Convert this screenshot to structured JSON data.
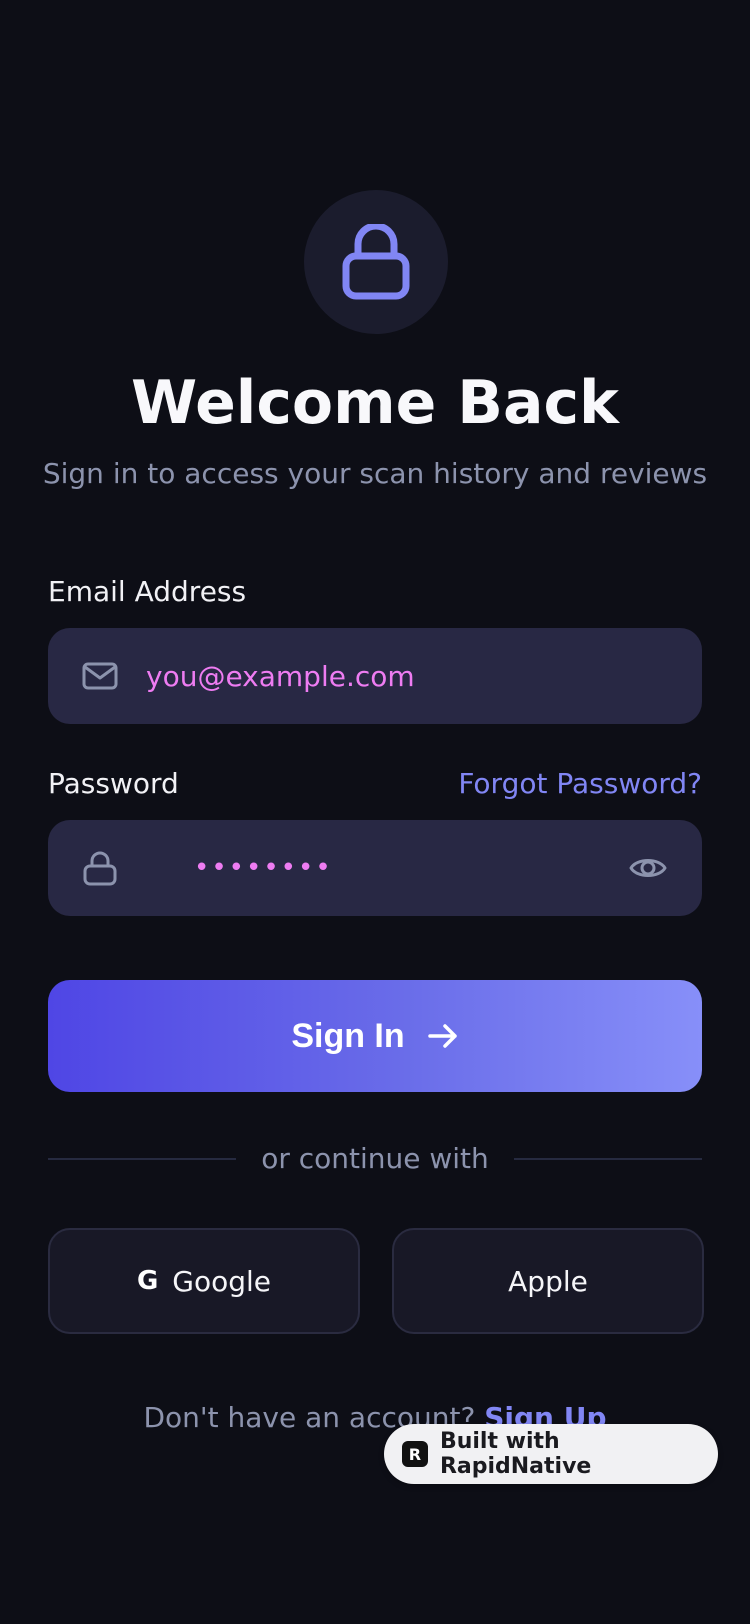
{
  "header": {
    "logo_icon": "lock-icon",
    "title": "Welcome Back",
    "subtitle": "Sign in to access your scan history and reviews"
  },
  "email": {
    "label": "Email Address",
    "placeholder": "you@example.com",
    "icon": "mail-icon"
  },
  "password": {
    "label": "Password",
    "forgot_label": "Forgot Password?",
    "masked_value": "••••••••",
    "icon": "lock-icon",
    "toggle_icon": "eye-icon"
  },
  "signin": {
    "label": "Sign In",
    "icon": "arrow-right-icon"
  },
  "divider": {
    "text": "or continue with"
  },
  "social": {
    "google_glyph": "G",
    "google_label": "Google",
    "apple_label": "Apple"
  },
  "signup": {
    "prompt": "Don't have an account? ",
    "link_label": "Sign Up"
  },
  "badge": {
    "logo_glyph": "R",
    "label": "Built with RapidNative"
  },
  "colors": {
    "background": "#0d0e16",
    "accent": "#8186f4",
    "input_bg": "#282844",
    "input_text": "#ee7cf2",
    "button_gradient_start": "#4f46e5",
    "button_gradient_end": "#878ff9"
  }
}
